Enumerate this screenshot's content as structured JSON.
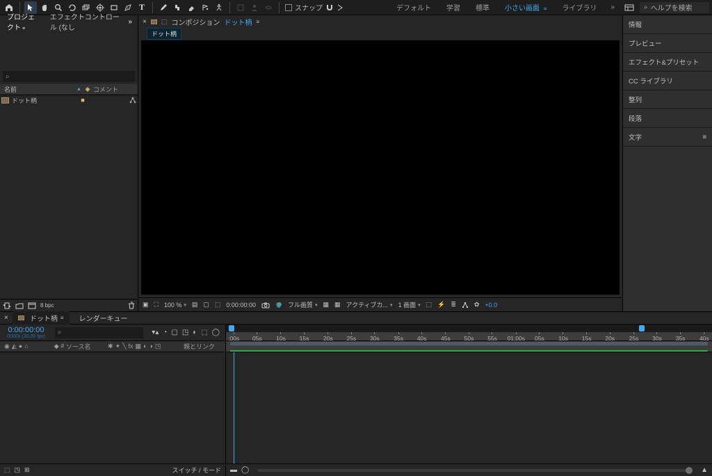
{
  "toolbar": {
    "snap_label": "スナップ",
    "tool_names": [
      "home",
      "selection",
      "hand",
      "zoom",
      "orbit",
      "rotate",
      "rect",
      "roundrect",
      "pen",
      "type",
      "pencil",
      "clone",
      "eraser",
      "brush",
      "puppet",
      "pin"
    ]
  },
  "workspaces": {
    "items": [
      "デフォルト",
      "学習",
      "標準",
      "小さい画面",
      "ライブラリ"
    ],
    "active_index": 3,
    "help_placeholder": "ヘルプを検索"
  },
  "project": {
    "tab_project": "プロジェクト",
    "tab_effect_controls": "エフェクトコントロール (なし",
    "col_name": "名前",
    "col_comment": "コメント",
    "item_name": "ドット柄",
    "bitdepth": "8 bpc"
  },
  "viewer": {
    "composition_label": "コンポジション",
    "composition_name": "ドット柄",
    "timecode": "0:00:00:00",
    "zoom": "100 %",
    "quality": "フル画質",
    "active_cam": "アクティブカ...",
    "view_count": "1 画面",
    "exposure": "+0.0"
  },
  "right_panels": [
    "情報",
    "プレビュー",
    "エフェクト&プリセット",
    "CC ライブラリ",
    "整列",
    "段落",
    "文字"
  ],
  "timeline": {
    "tab_name": "ドット柄",
    "renderqueue": "レンダーキュー",
    "timecode": "0:00:00:00",
    "frames": "00000 (30.00 fps)",
    "col_source": "ソース名",
    "col_parent": "親とリンク",
    "switch_mode": "スイッチ / モード",
    "ticks": [
      {
        "label": ":00s",
        "pos": 0.016
      },
      {
        "label": "05s",
        "pos": 0.064
      },
      {
        "label": "10s",
        "pos": 0.113
      },
      {
        "label": "15s",
        "pos": 0.161
      },
      {
        "label": "20s",
        "pos": 0.21
      },
      {
        "label": "25s",
        "pos": 0.258
      },
      {
        "label": "30s",
        "pos": 0.306
      },
      {
        "label": "35s",
        "pos": 0.355
      },
      {
        "label": "40s",
        "pos": 0.403
      },
      {
        "label": "45s",
        "pos": 0.452
      },
      {
        "label": "50s",
        "pos": 0.5
      },
      {
        "label": "55s",
        "pos": 0.548
      },
      {
        "label": "01:00s",
        "pos": 0.597
      },
      {
        "label": "05s",
        "pos": 0.645
      },
      {
        "label": "10s",
        "pos": 0.694
      },
      {
        "label": "15s",
        "pos": 0.742
      },
      {
        "label": "20s",
        "pos": 0.79
      },
      {
        "label": "25s",
        "pos": 0.839
      },
      {
        "label": "30s",
        "pos": 0.887
      },
      {
        "label": "35s",
        "pos": 0.935
      },
      {
        "label": "40s",
        "pos": 0.984
      }
    ],
    "playhead_pos": 0.016,
    "work_end_pos": 0.855
  }
}
